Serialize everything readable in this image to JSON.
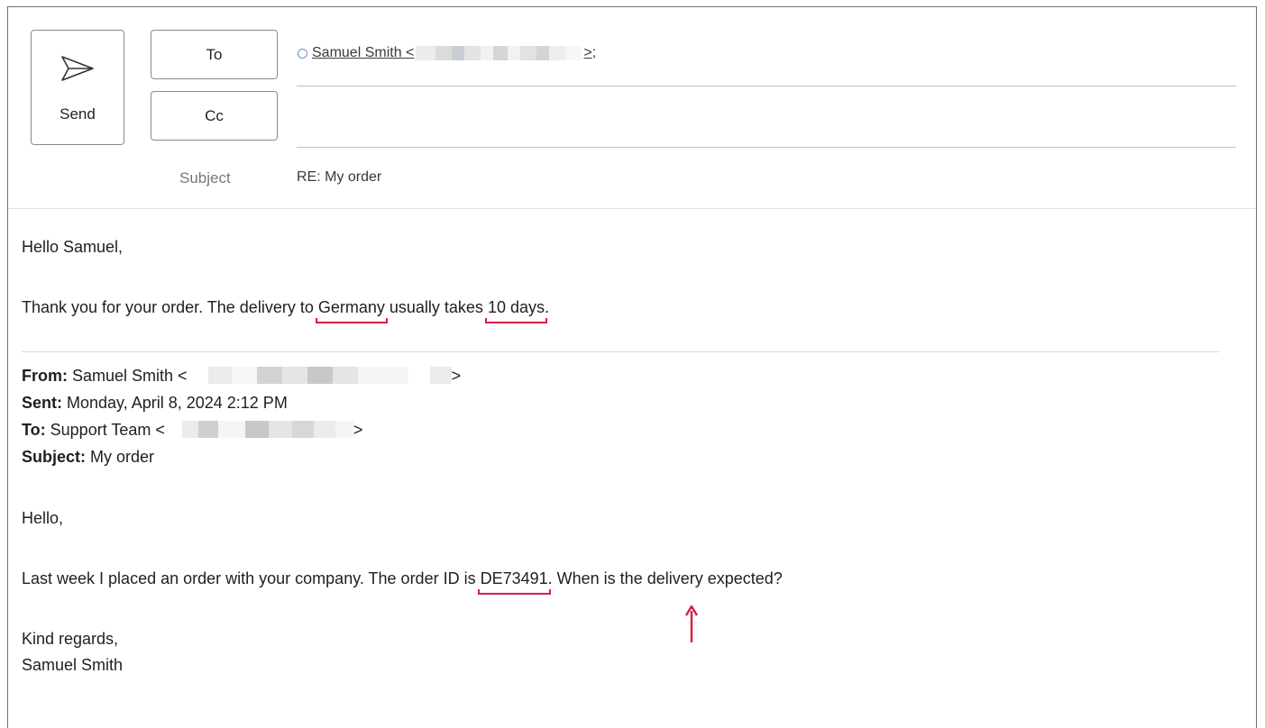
{
  "compose": {
    "send_label": "Send",
    "to_label": "To",
    "cc_label": "Cc",
    "subject_label": "Subject",
    "to_recipient_name": "Samuel Smith <",
    "to_recipient_end": ">;",
    "subject_value": "RE: My order"
  },
  "message": {
    "greeting": "Hello Samuel,",
    "reply_part1": "Thank you for your order. The delivery to ",
    "reply_country": "Germany",
    "reply_part2": " usually takes ",
    "reply_duration": "10 days",
    "reply_part3": "."
  },
  "quoted": {
    "from_label": "From:",
    "from_value": " Samuel Smith <",
    "from_end": ">",
    "sent_label": "Sent:",
    "sent_value": " Monday, April 8, 2024 2:12 PM",
    "to_label": "To:",
    "to_value": " Support Team <",
    "to_end": ">",
    "subject_label": "Subject:",
    "subject_value": " My order",
    "greeting": "Hello,",
    "body_part1": "Last week I placed an order with your company. The order ID is ",
    "order_id": "DE73491",
    "body_part2": ". When is the delivery expected?",
    "closing": "Kind regards,",
    "signature": "Samuel Smith"
  },
  "colors": {
    "annotation": "#d7204a",
    "redaction_light": "#ececec",
    "redaction_dark": "#c8c8c8"
  }
}
